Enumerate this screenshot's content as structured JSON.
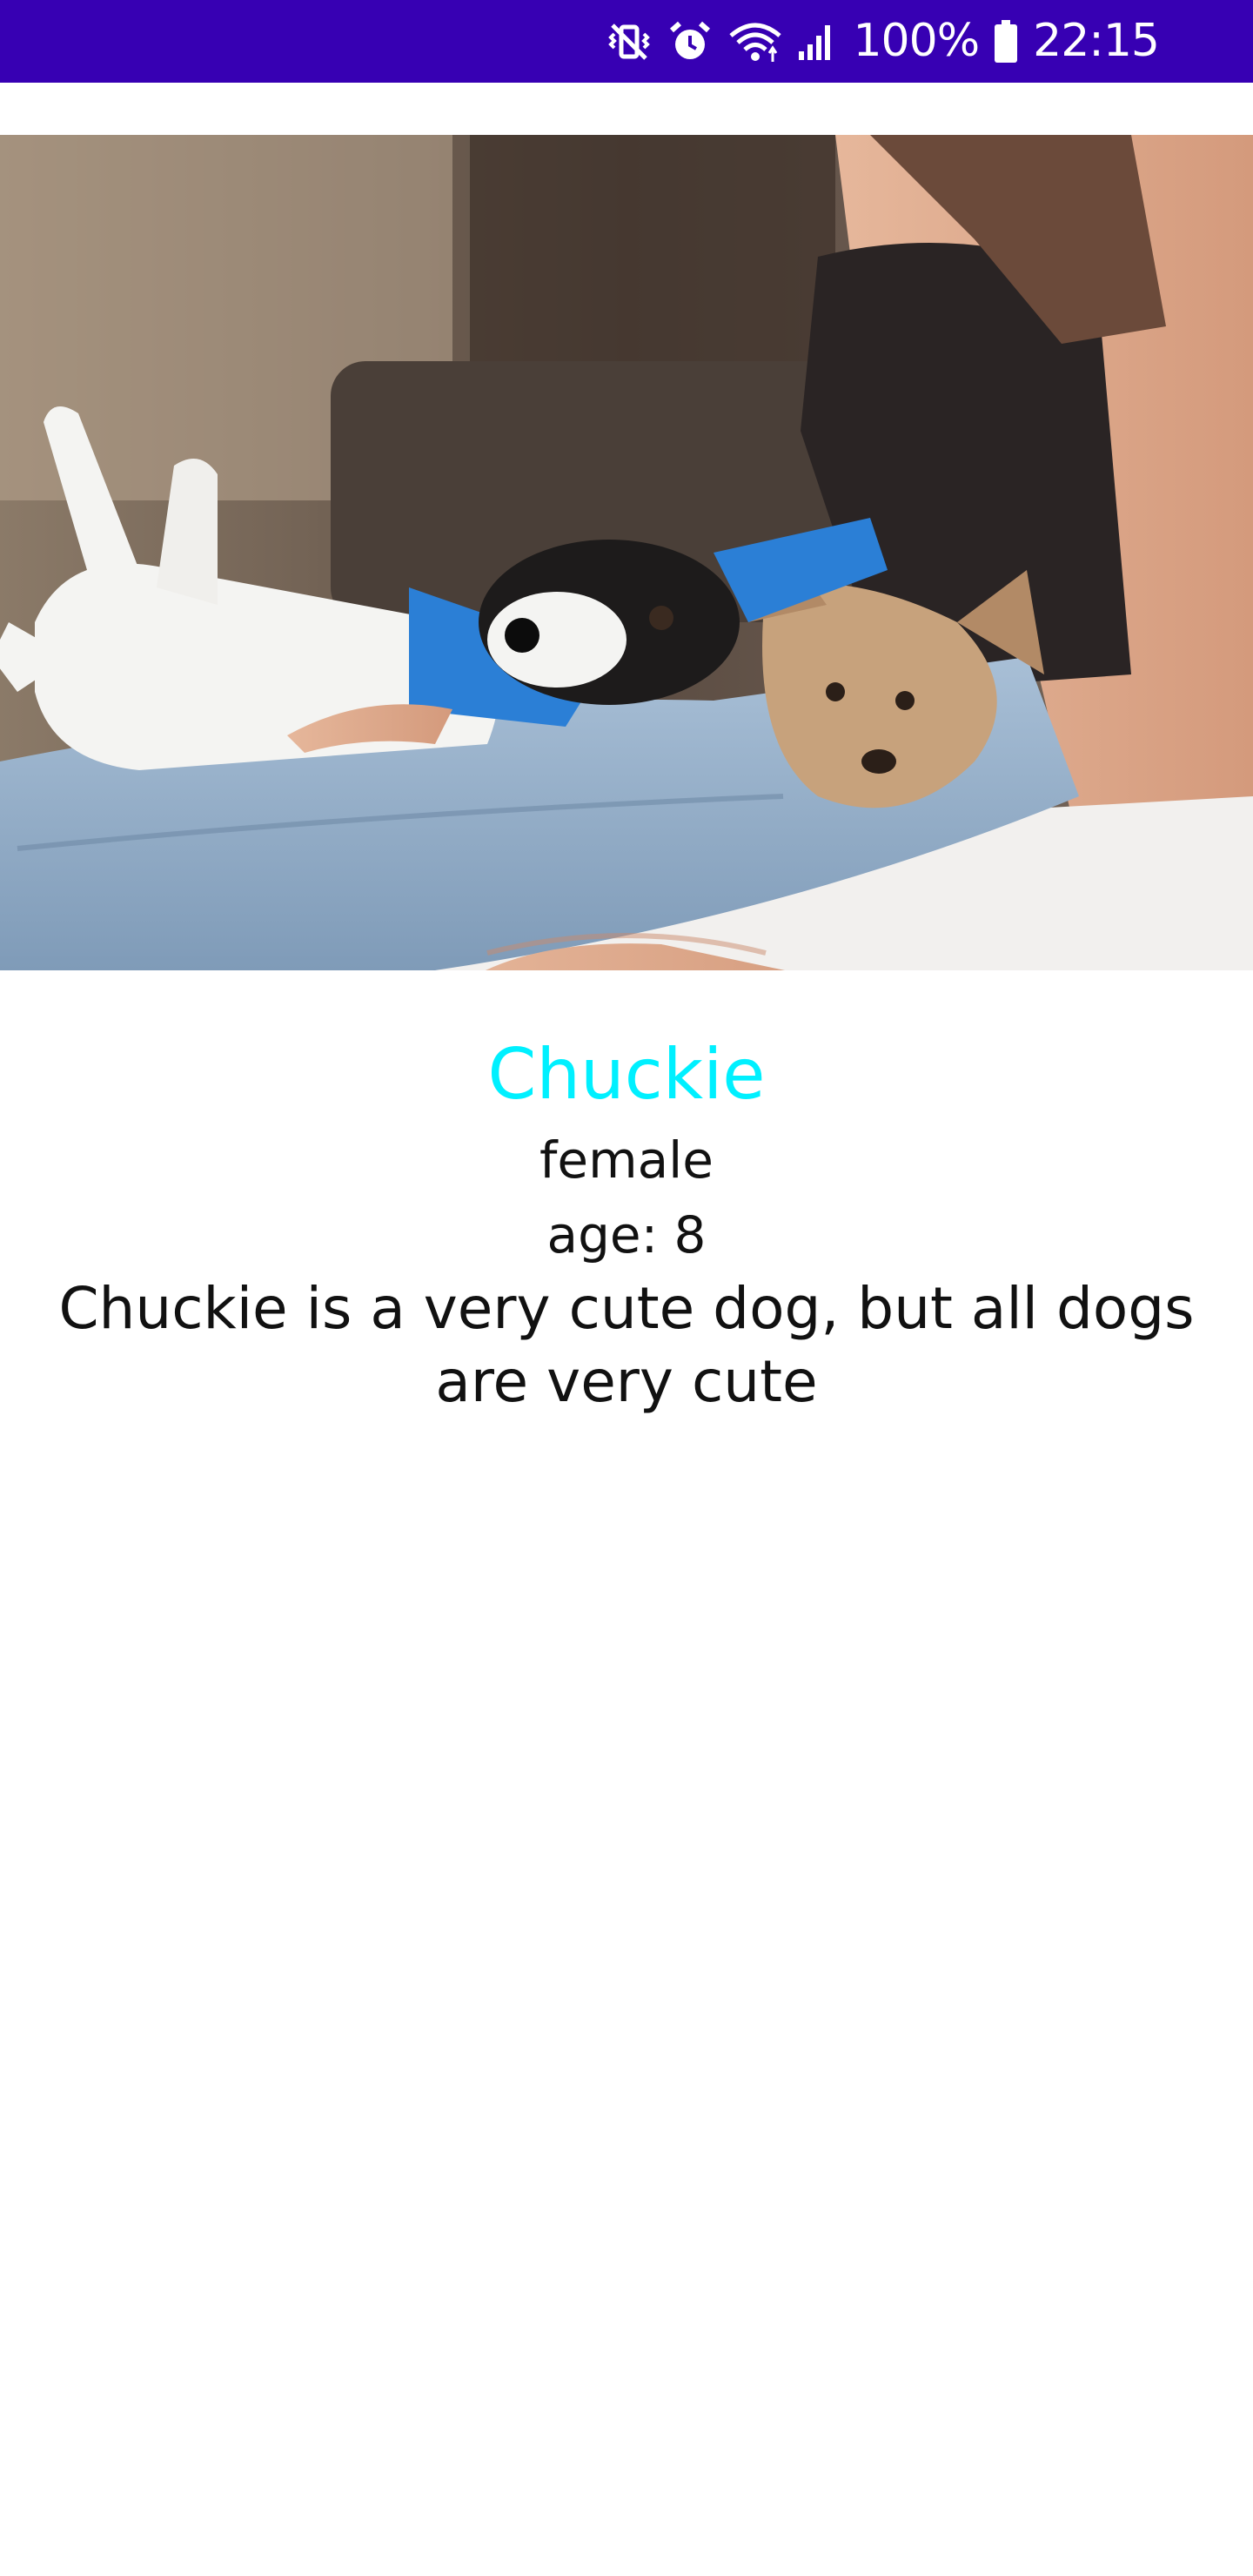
{
  "status_bar": {
    "battery": "100%",
    "time": "22:15",
    "icons": [
      "vibrate-muted-icon",
      "alarm-icon",
      "wifi-icon",
      "signal-icon",
      "battery-icon"
    ],
    "background": "#3700b3"
  },
  "dog": {
    "name": "Chuckie",
    "gender": "female",
    "age": "age: 8",
    "description": "Chuckie is a very cute dog, but all dogs are very cute",
    "name_color": "#00f0ff"
  },
  "hero_image": {
    "subject": "person-in-jeans-with-two-dogs-photo"
  }
}
